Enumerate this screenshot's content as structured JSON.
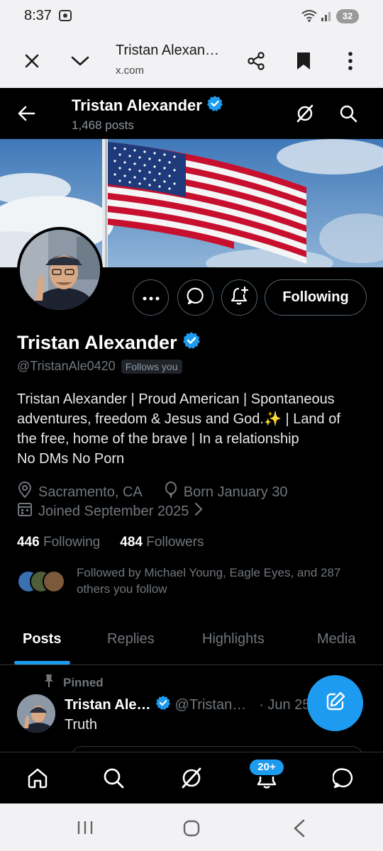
{
  "status_bar": {
    "time": "8:37",
    "battery": "32",
    "icons": [
      "screenshot-icon",
      "wifi-icon",
      "signal-icon",
      "battery-icon"
    ]
  },
  "browser": {
    "title": "Tristan Alexan…",
    "url": "x.com",
    "icons": [
      "close-icon",
      "chevron-down-icon",
      "share-icon",
      "bookmark-icon",
      "more-vertical-icon"
    ]
  },
  "header": {
    "name": "Tristan Alexander",
    "posts_count": "1,468 posts",
    "icons": [
      "back-arrow-icon",
      "grok-icon",
      "search-icon"
    ]
  },
  "profile": {
    "name": "Tristan Alexander",
    "handle": "@TristanAle0420",
    "follows_you": "Follows you",
    "following_button": "Following",
    "bio_lines": [
      "Tristan Alexander | Proud American | Spontaneous",
      "adventures, freedom & Jesus and God.✨ | Land of",
      "the free, home of the brave | In a relationship",
      "No DMs No Porn"
    ],
    "location": "Sacramento, CA",
    "birthday": "Born January 30",
    "joined": "Joined September 2025",
    "following_count": "446",
    "following_label": "Following",
    "followers_count": "484",
    "followers_label": "Followers",
    "followed_by_line1": "Followed by Michael Young, Eagle Eyes, and 287",
    "followed_by_line2": "others you follow"
  },
  "tabs": [
    {
      "label": "Posts",
      "active": true
    },
    {
      "label": "Replies",
      "active": false
    },
    {
      "label": "Highlights",
      "active": false
    },
    {
      "label": "Media",
      "active": false
    }
  ],
  "pinned_post": {
    "pinned_label": "Pinned",
    "author": "Tristan Ale…",
    "handle": "@Tristan…",
    "date": "· Jun 25",
    "text": "Truth"
  },
  "bottom_nav": {
    "notification_badge": "20+",
    "icons": [
      "home-icon",
      "search-icon",
      "grok-icon",
      "notifications-icon",
      "messages-icon"
    ]
  },
  "colors": {
    "accent": "#1d9bf0",
    "background": "#000000",
    "secondary_text": "#71767b",
    "border": "#2f3336"
  }
}
